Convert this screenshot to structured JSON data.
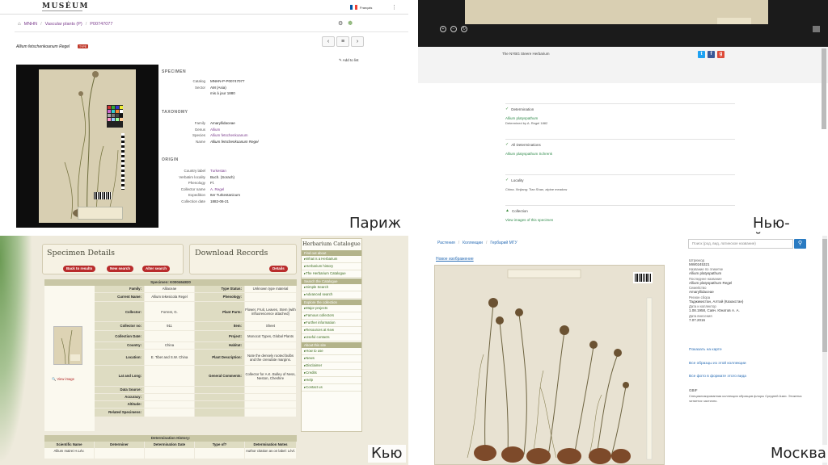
{
  "labels": {
    "paris": "Париж",
    "new_york": "Нью-Йорк",
    "kew": "Кью",
    "moscow": "Москва"
  },
  "paris": {
    "logo": "MUSÉUM",
    "language": "Français",
    "breadcrumb": [
      "MNHN",
      "Vascular plants (P)",
      "P00747077"
    ],
    "title": "Allium fetschenkoanum Regel",
    "badge": "TYPE",
    "add_to_list": "Add to list",
    "sections": {
      "specimen": "SPECIMEN",
      "taxonomy": "TAXONOMY",
      "origin": "ORIGIN"
    },
    "specimen_rows": [
      {
        "k": "Catalog",
        "v": "MNHN-P-P00747077"
      },
      {
        "k": "Sector",
        "v": "AM (Asia)"
      },
      {
        "k": "",
        "v": "mis à jour 1880"
      }
    ],
    "taxonomy_rows": [
      {
        "k": "Family",
        "v": "Amaryllidaceae"
      },
      {
        "k": "Genus",
        "v": "Allium"
      },
      {
        "k": "Species",
        "v": "Allium fetschenkoanum"
      },
      {
        "k": "Name",
        "v": "Allium fetschenkoanum Regel"
      }
    ],
    "origin_rows": [
      {
        "k": "Country label",
        "v": "Turkestan"
      },
      {
        "k": "Verbatim locality",
        "v": "Buch. (Sorach)"
      },
      {
        "k": "Phenology",
        "v": "Fl."
      },
      {
        "k": "Collector name",
        "v": "A. Regel"
      },
      {
        "k": "Expedition",
        "v": "Iter Turkestanicum"
      },
      {
        "k": "Collection date",
        "v": "1882-06-21"
      }
    ]
  },
  "new_york": {
    "caption": "The NYBG Steere Herbarium",
    "cards": [
      {
        "icon": "check",
        "head": "Determination",
        "line": "Allium platyspathum",
        "sub": "Determined by A. Regel 1882"
      },
      {
        "icon": "check",
        "head": "All Determinations",
        "line": "Allium platyspathum Schrenk"
      },
      {
        "icon": "check",
        "head": "Locality",
        "sub": "China. Xinjiang: Tian Shan, alpine meadow"
      },
      {
        "icon": "leaf",
        "head": "Collection",
        "line": "View images of this specimen"
      }
    ]
  },
  "kew": {
    "specimen_details": "Specimen Details",
    "download_records": "Download Records",
    "buttons": [
      "Back to results",
      "New search",
      "Alter search"
    ],
    "details_btn": "Details",
    "specimen_header": "Specimen: K000464820",
    "view_image": "View image",
    "rows": [
      {
        "k1": "Family:",
        "v1": "Alliaceae",
        "k2": "Type Status:",
        "v2": "Unknown type material"
      },
      {
        "k1": "Current Name:",
        "v1": "Allium tekesicola Regel",
        "k2": "Phenology:",
        "v2": ""
      },
      {
        "k1": "Collector:",
        "v1": "Forrest, G.",
        "k2": "Plant Parts:",
        "v2": "Flower, Fruit, Leaves, Stem (with influorescence attached)"
      },
      {
        "k1": "Collector no:",
        "v1": "911",
        "k2": "Item:",
        "v2": "Sheet"
      },
      {
        "k1": "Collection Date:",
        "v1": "",
        "k2": "Project:",
        "v2": "Monocot Types, Global Plants"
      },
      {
        "k1": "Country:",
        "v1": "China",
        "k2": "Habitat:",
        "v2": ""
      },
      {
        "k1": "Location:",
        "v1": "E. Tibet and S.W. China",
        "k2": "Plant Description:",
        "v2": "Note the densely rooted bulbs and the crenulate margins."
      },
      {
        "k1": "Lat and Long:",
        "v1": "",
        "k2": "General Comments:",
        "v2": "Collector for A.K. Bulley of Ness, Neston, Cheshire"
      },
      {
        "k1": "Data Source:",
        "v1": "",
        "k2": "",
        "v2": ""
      },
      {
        "k1": "Accuracy:",
        "v1": "",
        "k2": "",
        "v2": ""
      },
      {
        "k1": "Altitude:",
        "v1": "",
        "k2": "",
        "v2": ""
      },
      {
        "k1": "Related Specimens:",
        "v1": "",
        "k2": "",
        "v2": ""
      }
    ],
    "det_header": "Determination History:",
    "det_cols": [
      "Scientific Name",
      "Determiner",
      "Determination Date",
      "Type of?",
      "Determination Notes"
    ],
    "det_row": [
      "Allium mairei H.Lév.",
      "",
      "",
      "",
      "Author citation as on label: Lévl."
    ],
    "sidebar": {
      "title": "Herbarium Catalogue",
      "groups": [
        {
          "name": "Find out about",
          "items": [
            "What is a Herbarium",
            "Herbarium history",
            "The Herbarium Catalogue"
          ]
        },
        {
          "name": "Search the Catalogue",
          "items": [
            "Simple Search",
            "Advanced search"
          ]
        },
        {
          "name": "Explore the collection",
          "items": [
            "Major projects",
            "Famous collectors",
            "Further information",
            "Resources at Kew",
            "Useful contacts"
          ]
        },
        {
          "name": "About this site",
          "items": [
            "How to use",
            "News",
            "Disclaimer",
            "Credits",
            "Help",
            "Contact us"
          ]
        }
      ]
    }
  },
  "moscow": {
    "breadcrumb": [
      "Растения",
      "Коллекции",
      "Гербарий МГУ"
    ],
    "search_placeholder": "Поиск (род, вид, латинское название)",
    "tab": "Новое изображение",
    "info": [
      {
        "k": "Штрихкод",
        "v": "MW0245321"
      },
      {
        "k": "Название по этикетке",
        "v": "Allium platyspathum"
      },
      {
        "k": "Последнее название",
        "v": "Allium platyspathum Regel"
      },
      {
        "k": "Семейство",
        "v": "Amaryllidaceae"
      },
      {
        "k": "Регион сбора",
        "v": "Таджикистан, Алтай (Казахстан)"
      },
      {
        "k": "Дата и коллектор",
        "v": "1.08.1958, Савч. Юнатов А. А."
      },
      {
        "k": "Дата внесения",
        "v": "7.07.2016"
      }
    ],
    "links": [
      "Показать на карте",
      "Все образцы из этой коллекции",
      "Все фото в формате этого вида"
    ],
    "note_head": "GBIF",
    "note": "Специализированная коллекция образцов флоры Средней Азии. Этикетка читается частично."
  }
}
